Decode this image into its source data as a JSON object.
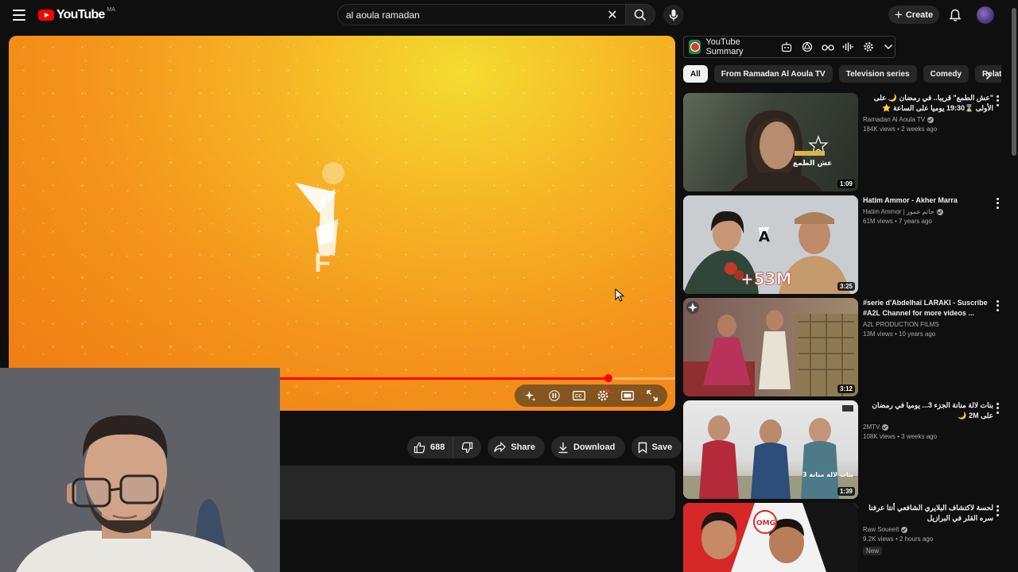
{
  "header": {
    "logo_text": "YouTube",
    "logo_country": "MA",
    "search_value": "al aoula ramadan",
    "create_label": "Create"
  },
  "player": {
    "progress_fraction": 0.9,
    "logo_text": "F"
  },
  "actions": {
    "like_count": "688",
    "share_label": "Share",
    "download_label": "Download",
    "save_label": "Save"
  },
  "extension": {
    "title": "YouTube Summary"
  },
  "chips": [
    "All",
    "From Ramadan Al Aoula TV",
    "Television series",
    "Comedy",
    "Related"
  ],
  "recommendations": [
    {
      "title": "\"عش الطمع\" قريبا.. في رمضان 🌙 على الأولى ⌛19:30 يوميا على الساعة ⭐",
      "channel": "Ramadan Al Aoula TV",
      "verified": true,
      "meta": "184K views • 2 weeks ago",
      "duration": "1:09",
      "thumb_caption": "عش الطمع"
    },
    {
      "title": "Hatim Ammor - Akher Marra",
      "channel": "Hatim Ammor | حاتم عمور",
      "verified": true,
      "meta": "61M views • 7 years ago",
      "duration": "3:25",
      "thumb_caption": "+53M"
    },
    {
      "title": "#serie d'Abdelhaï LARAKI - Suscribe #A2L Channel for more videos ...",
      "channel": "A2L PRODUCTION FILMS",
      "verified": false,
      "meta": "13M views • 10 years ago",
      "duration": "3:12",
      "thumb_caption": ""
    },
    {
      "title": "بنات لالة منانة الجزء 3... يوميا في رمضان على 2M 🌙",
      "channel": "2MTV",
      "verified": true,
      "meta": "108K views • 3 weeks ago",
      "duration": "1:39",
      "thumb_caption": "بنات لالة منانة 3"
    },
    {
      "title": "لحسة لاكتشاف البلايري الشافعي أنتا عرفنا سره القلر في البرازيل",
      "channel": "Raw Soueelt",
      "verified": true,
      "meta": "9.2K views • 2 hours ago",
      "badge": "New",
      "duration": "",
      "thumb_caption": "OMG"
    }
  ]
}
